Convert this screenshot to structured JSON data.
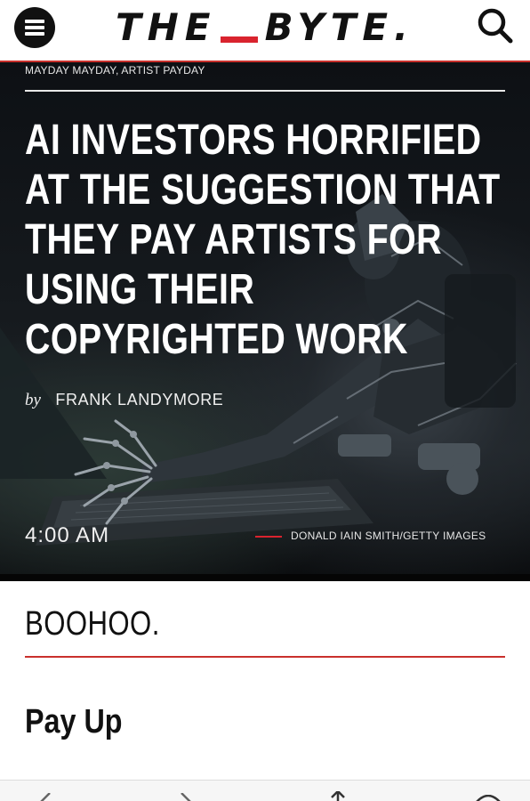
{
  "header": {
    "menu_icon": "hamburger-menu-icon",
    "logo_left": "THE",
    "logo_right": "BYTE.",
    "search_icon": "search-icon",
    "accent_color": "#d9232e"
  },
  "hero": {
    "kicker": "MAYDAY MAYDAY, ARTIST PAYDAY",
    "headline_lines": [
      "AI INVESTORS HORRIFIED",
      "AT THE SUGGESTION THAT",
      "THEY PAY ARTISTS FOR",
      "USING THEIR",
      "COPYRIGHTED WORK"
    ],
    "byline_prefix": "by",
    "author": "FRANK LANDYMORE",
    "time": "4:00 AM",
    "image_credit": "DONALD IAIN SMITH/GETTY IMAGES"
  },
  "article": {
    "dek": "BOOHOO.",
    "subhead": "Pay Up"
  },
  "bottom_bar": {
    "icons": [
      "back-arrow-icon",
      "forward-arrow-icon",
      "share-icon",
      "compass-icon"
    ]
  }
}
